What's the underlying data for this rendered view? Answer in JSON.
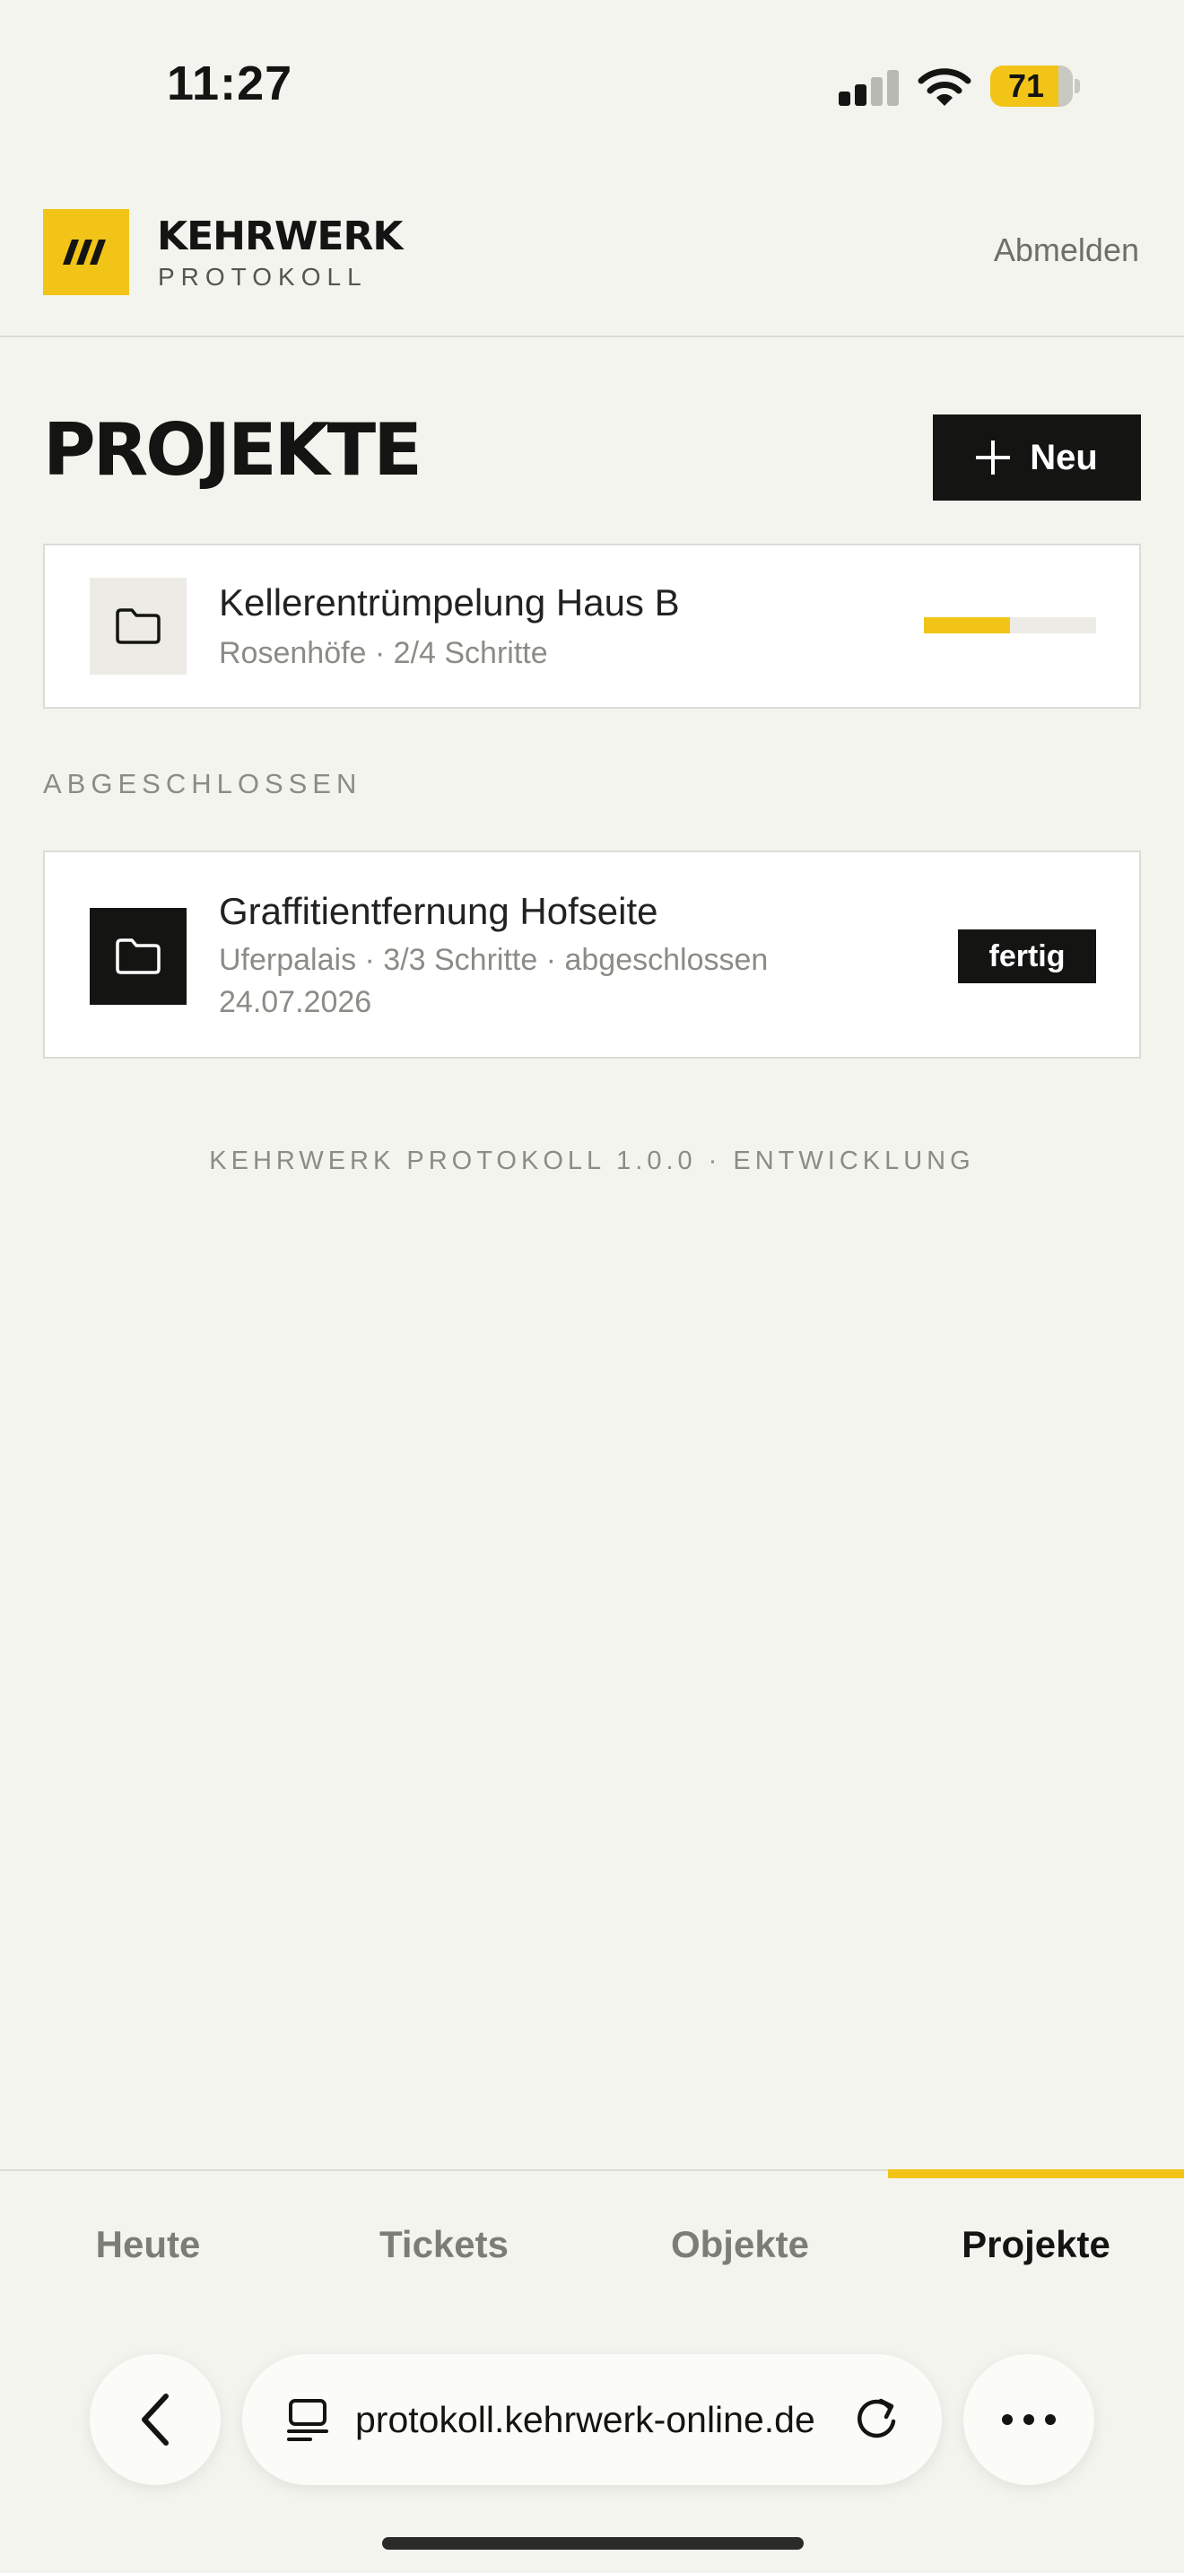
{
  "status": {
    "time": "11:27",
    "battery": "71",
    "signal_bars_active": 2
  },
  "header": {
    "brand_name": "KEHRWERK",
    "brand_sub": "PROTOKOLL",
    "logout_label": "Abmelden"
  },
  "page": {
    "title": "PROJEKTE",
    "new_label": "Neu"
  },
  "projects_active": [
    {
      "title": "Kellerentrümpelung Haus B",
      "meta": "Rosenhöfe · 2/4 Schritte",
      "progress": 0.5
    }
  ],
  "section_completed": "ABGESCHLOSSEN",
  "projects_completed": [
    {
      "title": "Graffitientfernung Hofseite",
      "meta_line1": "Uferpalais · 3/3 Schritte · abgeschlossen",
      "meta_line2": "24.07.2026",
      "badge": "fertig"
    }
  ],
  "footer": {
    "version": "KEHRWERK PROTOKOLL 1.0.0 · ENTWICKLUNG"
  },
  "tabs": [
    {
      "label": "Heute"
    },
    {
      "label": "Tickets"
    },
    {
      "label": "Objekte"
    },
    {
      "label": "Projekte",
      "active": true
    }
  ],
  "browser": {
    "url": "protokoll.kehrwerk-online.de"
  },
  "colors": {
    "accent": "#f2c417",
    "dark": "#141412",
    "background": "#f4f4ef"
  },
  "icons": [
    "back-icon",
    "tabs-icon",
    "reload-icon",
    "more-icon",
    "folder-icon",
    "plus-icon",
    "signal-icon",
    "wifi-icon",
    "battery-icon"
  ]
}
